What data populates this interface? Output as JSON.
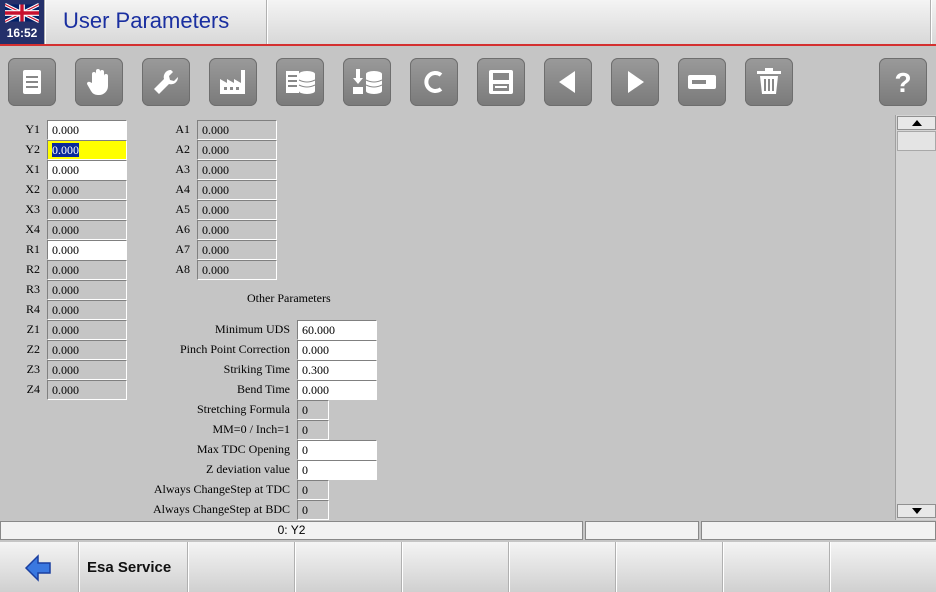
{
  "header": {
    "title": "User Parameters",
    "clock": "16:52"
  },
  "axes_left": [
    {
      "label": "Y1",
      "value": "0.000",
      "style": "w"
    },
    {
      "label": "Y2",
      "value": "0.000",
      "style": "sel"
    },
    {
      "label": "X1",
      "value": "0.000",
      "style": "w"
    },
    {
      "label": "X2",
      "value": "0.000",
      "style": "g"
    },
    {
      "label": "X3",
      "value": "0.000",
      "style": "g"
    },
    {
      "label": "X4",
      "value": "0.000",
      "style": "g"
    },
    {
      "label": "R1",
      "value": "0.000",
      "style": "w"
    },
    {
      "label": "R2",
      "value": "0.000",
      "style": "g"
    },
    {
      "label": "R3",
      "value": "0.000",
      "style": "g"
    },
    {
      "label": "R4",
      "value": "0.000",
      "style": "g"
    },
    {
      "label": "Z1",
      "value": "0.000",
      "style": "g"
    },
    {
      "label": "Z2",
      "value": "0.000",
      "style": "g"
    },
    {
      "label": "Z3",
      "value": "0.000",
      "style": "g"
    },
    {
      "label": "Z4",
      "value": "0.000",
      "style": "g"
    }
  ],
  "axes_right": [
    {
      "label": "A1",
      "value": "0.000"
    },
    {
      "label": "A2",
      "value": "0.000"
    },
    {
      "label": "A3",
      "value": "0.000"
    },
    {
      "label": "A4",
      "value": "0.000"
    },
    {
      "label": "A5",
      "value": "0.000"
    },
    {
      "label": "A6",
      "value": "0.000"
    },
    {
      "label": "A7",
      "value": "0.000"
    },
    {
      "label": "A8",
      "value": "0.000"
    }
  ],
  "other": {
    "heading": "Other Parameters",
    "items": [
      {
        "label": "Minimum UDS",
        "value": "60.000",
        "width": "wide"
      },
      {
        "label": "Pinch Point Correction",
        "value": "0.000",
        "width": "wide"
      },
      {
        "label": "Striking Time",
        "value": "0.300",
        "width": "wide"
      },
      {
        "label": "Bend Time",
        "value": "0.000",
        "width": "wide"
      },
      {
        "label": "Stretching Formula",
        "value": "0",
        "width": "narrow"
      },
      {
        "label": "MM=0 / Inch=1",
        "value": "0",
        "width": "narrow"
      },
      {
        "label": "Max TDC Opening",
        "value": "0",
        "width": "wide"
      },
      {
        "label": "Z deviation value",
        "value": "0",
        "width": "wide"
      },
      {
        "label": "Always ChangeStep at TDC",
        "value": "0",
        "width": "narrow"
      },
      {
        "label": "Always ChangeStep at BDC",
        "value": "0",
        "width": "narrow"
      }
    ]
  },
  "toolbar": [
    "document-icon",
    "hand-icon",
    "wrench-icon",
    "factory-icon",
    "database-list-icon",
    "database-import-icon",
    "c-icon",
    "save-icon",
    "arrow-left-icon",
    "arrow-right-icon",
    "card-icon",
    "trash-icon",
    "help-icon"
  ],
  "status": {
    "cell1": "0: Y2",
    "cell2": "",
    "cell3": ""
  },
  "footer": {
    "service_label": "Esa Service"
  }
}
